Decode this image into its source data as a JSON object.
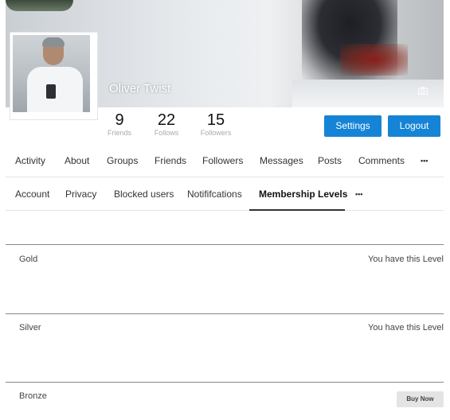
{
  "profile": {
    "name": "Oliver Twist",
    "stats": [
      {
        "value": "9",
        "label": "Friends"
      },
      {
        "value": "22",
        "label": "Follows"
      },
      {
        "value": "15",
        "label": "Followers"
      }
    ],
    "settings_label": "Settings",
    "logout_label": "Logout"
  },
  "main_nav": {
    "items": [
      "Activity",
      "About",
      "Groups",
      "Friends",
      "Followers",
      "Messages",
      "Posts",
      "Comments",
      "•••"
    ]
  },
  "sub_nav": {
    "items": [
      "Account",
      "Privacy",
      "Blocked users",
      "Notififcations",
      "Membership Levels",
      "•••"
    ],
    "active": "Membership Levels"
  },
  "levels": [
    {
      "name": "Gold",
      "status": "You have this Level"
    },
    {
      "name": "Silver",
      "status": "You have this Level"
    },
    {
      "name": "Bronze",
      "action": "Buy Now"
    }
  ],
  "colors": {
    "accent": "#1584d6",
    "cover_text": "#ffffff"
  },
  "icons": {
    "camera": "camera-icon",
    "more": "more-icon"
  }
}
